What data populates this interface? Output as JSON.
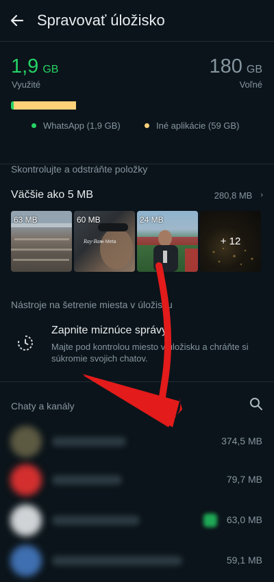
{
  "header": {
    "title": "Spravovať úložisko",
    "back_icon": "arrow-left-icon"
  },
  "storage": {
    "used_value": "1,9",
    "used_unit": "GB",
    "used_label": "Využité",
    "free_value": "180",
    "free_unit": "GB",
    "free_label": "Voľné",
    "whatsapp_fraction": 0.01,
    "other_fraction": 0.25,
    "legend_whatsapp": "WhatsApp (1,9 GB)",
    "legend_other": "Iné aplikácie (59 GB)",
    "colors": {
      "whatsapp": "#25d366",
      "other": "#ffd279"
    }
  },
  "review": {
    "section_label": "Skontrolujte a odstráňte položky",
    "larger_label": "Väčšie ako 5 MB",
    "larger_size": "280,8 MB",
    "thumbs": [
      {
        "caption": "63 MB"
      },
      {
        "caption": "60 MB"
      },
      {
        "caption": "24 MB"
      },
      {
        "caption": "+ 12"
      }
    ]
  },
  "tools": {
    "section_label": "Nástroje na šetrenie miesta v úložisku",
    "disappearing_title": "Zapnite miznúce správy",
    "disappearing_desc": "Majte pod kontrolou miesto v úložisku a chráňte si súkromie svojich chatov.",
    "icon": "timer-icon"
  },
  "chats": {
    "section_label": "Chaty a kanály",
    "search_icon": "search-icon",
    "rows": [
      {
        "size": "374,5 MB"
      },
      {
        "size": "79,7 MB"
      },
      {
        "size": "63,0 MB"
      },
      {
        "size": "59,1 MB"
      }
    ]
  }
}
